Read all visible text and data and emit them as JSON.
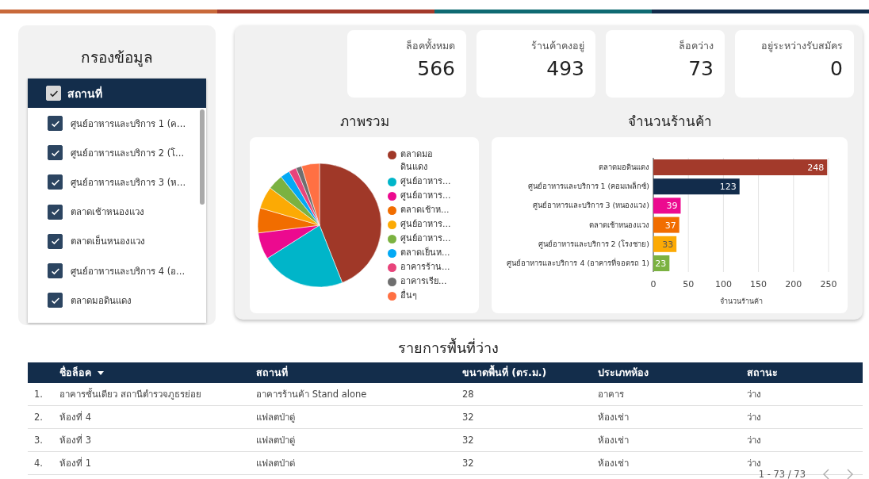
{
  "top_stripe": [
    {
      "color": "#c8693a"
    },
    {
      "color": "#a33a2b"
    },
    {
      "color": "#0f6a72"
    },
    {
      "color": "#122c4b"
    }
  ],
  "filter": {
    "title": "กรองข้อมูล",
    "header": {
      "label": "สถานที่",
      "checked": true
    },
    "items": [
      {
        "label": "ศูนย์อาหารและบริการ 1 (ค...",
        "checked": true
      },
      {
        "label": "ศูนย์อาหารและบริการ 2 (โ...",
        "checked": true
      },
      {
        "label": "ศูนย์อาหารและบริการ 3 (ห...",
        "checked": true
      },
      {
        "label": "ตลาดเช้าหนองแวง",
        "checked": true
      },
      {
        "label": "ตลาดเย็นหนองแวง",
        "checked": true
      },
      {
        "label": "ศูนย์อาหารและบริการ 4 (อ...",
        "checked": true
      },
      {
        "label": "ตลาดมอดินแดง",
        "checked": true
      }
    ]
  },
  "kpis": [
    {
      "label": "ล็อคทั้งหมด",
      "value": "566"
    },
    {
      "label": "ร้านค้าคงอยู่",
      "value": "493"
    },
    {
      "label": "ล็อคว่าง",
      "value": "73"
    },
    {
      "label": "อยู่ระหว่างรับสมัคร",
      "value": "0"
    }
  ],
  "overview": {
    "title": "ภาพรวม",
    "legend": [
      {
        "label": "ตลาดมอดินแดง",
        "color": "#a03828"
      },
      {
        "label": "ศูนย์อาหาร...",
        "color": "#00b5c9"
      },
      {
        "label": "ศูนย์อาหาร...",
        "color": "#ec0a8f"
      },
      {
        "label": "ตลาดเช้าห...",
        "color": "#f16d00"
      },
      {
        "label": "ศูนย์อาหาร...",
        "color": "#fcaa04"
      },
      {
        "label": "ศูนย์อาหาร...",
        "color": "#7bb241"
      },
      {
        "label": "ตลาดเย็นห...",
        "color": "#03a9f4"
      },
      {
        "label": "อาคารร้าน...",
        "color": "#e8447b"
      },
      {
        "label": "อาคารเรีย...",
        "color": "#6f6f6f"
      },
      {
        "label": "อื่นๆ",
        "color": "#ff7043"
      }
    ]
  },
  "shops": {
    "title": "จำนวนร้านค้า",
    "chart_data": {
      "type": "bar",
      "orientation": "horizontal",
      "stacked": true,
      "xlabel": "จำนวนร้านค้า",
      "grid": true,
      "xlim": [
        0,
        250
      ],
      "xticks": [
        0,
        50,
        100,
        150,
        200,
        250
      ],
      "data_labels": true,
      "series": [
        {
          "name": "ตลาดมอดินแดง",
          "color": "#a33a2b",
          "values": [
            248,
            null,
            null,
            null,
            null,
            null
          ]
        },
        {
          "name": "ศูนย์อาหารและบริการ 1 (คอมเพล็กซ์)",
          "color": "#122c4b",
          "values": [
            null,
            123,
            null,
            null,
            null,
            null
          ]
        },
        {
          "name": "ศูนย์อาหารและบริการ 3 (หนองแวง)",
          "color": "#ec0a8f",
          "values": [
            null,
            null,
            39,
            null,
            null,
            null
          ]
        },
        {
          "name": "ตลาดเช้าหนองแวง",
          "color": "#f16d00",
          "values": [
            null,
            null,
            null,
            37,
            null,
            null
          ]
        },
        {
          "name": "ศูนย์อาหารและบริการ 2 (โรงชาย)",
          "color": "#fcaa04",
          "values": [
            null,
            null,
            null,
            null,
            33,
            null
          ]
        },
        {
          "name": "ศูนย์อาหารและบริการ 4 (อาคารที่จอดรถ 1)",
          "color": "#7bb241",
          "values": [
            null,
            null,
            null,
            null,
            null,
            23
          ]
        }
      ]
    }
  },
  "vacancies": {
    "title": "รายการพื้นที่ว่าง",
    "columns": [
      {
        "label": "ชื่อล็อค",
        "sorted": true
      },
      {
        "label": "สถานที่",
        "sorted": false
      },
      {
        "label": "ขนาดพื้นที่ (ตร.ม.)",
        "sorted": false
      },
      {
        "label": "ประเภทห้อง",
        "sorted": false
      },
      {
        "label": "สถานะ",
        "sorted": false
      }
    ],
    "rows": [
      {
        "index": "1.",
        "cells": [
          "อาคารชั้นเดียว สถานีตำรวจภูธรย่อย",
          "อาคารร้านค้า Stand alone",
          "28",
          "อาคาร",
          "ว่าง"
        ]
      },
      {
        "index": "2.",
        "cells": [
          "ห้องที่ 4",
          "แฟลตป่าดู่",
          "32",
          "ห้องเช่า",
          "ว่าง"
        ]
      },
      {
        "index": "3.",
        "cells": [
          "ห้องที่ 3",
          "แฟลตป่าดู่",
          "32",
          "ห้องเช่า",
          "ว่าง"
        ]
      },
      {
        "index": "4.",
        "cells": [
          "ห้องที่ 1",
          "แฟลตป่าด่",
          "32",
          "ห้องเช่า",
          "ว่าง"
        ]
      }
    ],
    "pagination": "1 - 73 / 73"
  }
}
